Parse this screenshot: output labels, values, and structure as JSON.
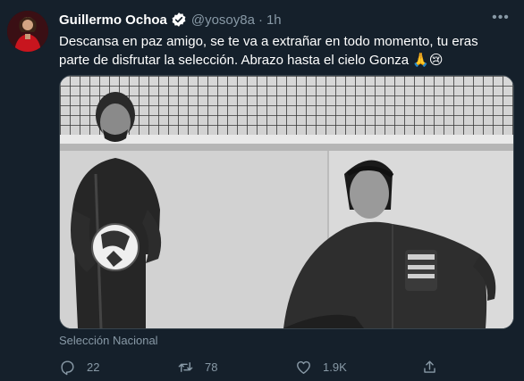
{
  "tweet": {
    "author_name": "Guillermo Ochoa",
    "handle": "@yosoy8a",
    "separator": "·",
    "time": "1h",
    "more_label": "•••",
    "text_line1": "Descansa en paz amigo, se te va a extrañar en todo momento, tu eras",
    "text_line2": "parte de disfrutar la selección. Abrazo hasta el cielo Gonza 🙏😢",
    "media_caption": "Selección Nacional"
  },
  "actions": {
    "replies": "22",
    "retweets": "78",
    "likes": "1.9K"
  },
  "colors": {
    "background": "#15202b",
    "secondary_text": "#8899a6",
    "verified": "#1da1f2",
    "border": "#38444d"
  }
}
